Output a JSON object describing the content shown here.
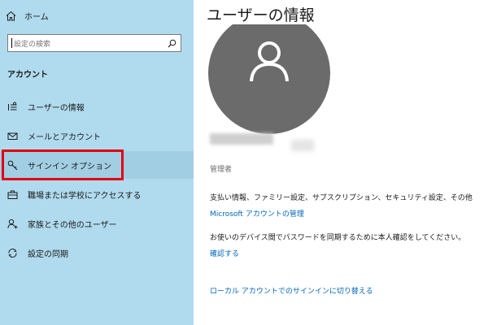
{
  "sidebar": {
    "home_label": "ホーム",
    "search_placeholder": "設定の検索",
    "section_title": "アカウント",
    "items": [
      {
        "label": "ユーザーの情報",
        "icon": "user-info-icon"
      },
      {
        "label": "メールとアカウント",
        "icon": "mail-icon"
      },
      {
        "label": "サインイン オプション",
        "icon": "key-icon"
      },
      {
        "label": "職場または学校にアクセスする",
        "icon": "briefcase-icon"
      },
      {
        "label": "家族とその他のユーザー",
        "icon": "person-add-icon"
      },
      {
        "label": "設定の同期",
        "icon": "sync-icon"
      }
    ],
    "selected_index": 2
  },
  "main": {
    "title": "ユーザーの情報",
    "role": "管理者",
    "billing_text": "支払い情報、ファミリー設定、サブスクリプション、セキュリティ設定、その他",
    "manage_link": "Microsoft アカウントの管理",
    "verify_text": "お使いのデバイス間でパスワードを同期するために本人確認をしてください。",
    "verify_link": "確認する",
    "local_link": "ローカル アカウントでのサインインに切り替える"
  },
  "colors": {
    "sidebar_bg": "#b0dbee",
    "selected_bg": "#a2cee3",
    "highlight_border": "#e2000f",
    "link": "#0067b8",
    "avatar": "#6b6b6b"
  }
}
